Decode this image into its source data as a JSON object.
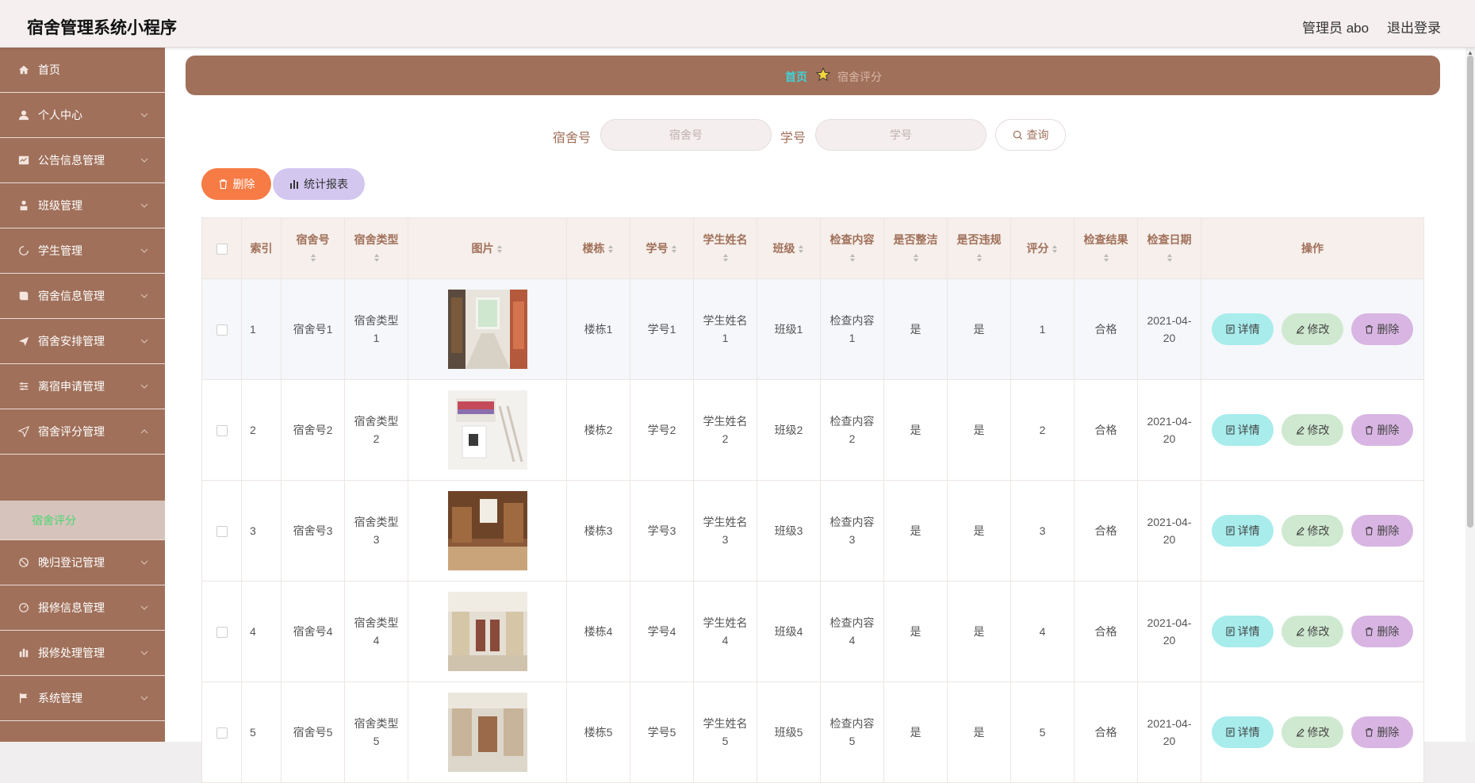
{
  "app": {
    "title": "宿舍管理系统小程序"
  },
  "header": {
    "user": "管理员 abo",
    "logout": "退出登录"
  },
  "sidebar": {
    "items": [
      {
        "label": "首页",
        "icon": "home-icon"
      },
      {
        "label": "个人中心",
        "icon": "user-icon"
      },
      {
        "label": "公告信息管理",
        "icon": "notice-icon"
      },
      {
        "label": "班级管理",
        "icon": "class-icon"
      },
      {
        "label": "学生管理",
        "icon": "student-icon"
      },
      {
        "label": "宿舍信息管理",
        "icon": "dorm-icon"
      },
      {
        "label": "宿舍安排管理",
        "icon": "send-icon"
      },
      {
        "label": "离宿申请管理",
        "icon": "sliders-icon"
      },
      {
        "label": "宿舍评分管理",
        "icon": "navigation-icon"
      },
      {
        "label": "晚归登记管理",
        "icon": "moon-icon"
      },
      {
        "label": "报修信息管理",
        "icon": "tool-icon"
      },
      {
        "label": "报修处理管理",
        "icon": "bar-icon"
      },
      {
        "label": "系统管理",
        "icon": "flag-icon"
      }
    ],
    "subitem": "宿舍评分"
  },
  "breadcrumb": {
    "home": "首页",
    "current": "宿舍评分"
  },
  "search": {
    "dorm_label": "宿舍号",
    "dorm_placeholder": "宿舍号",
    "student_label": "学号",
    "student_placeholder": "学号",
    "query": "查询"
  },
  "actions": {
    "delete": "删除",
    "stats": "统计报表"
  },
  "table": {
    "columns": [
      "索引",
      "宿舍号",
      "宿舍类型",
      "图片",
      "楼栋",
      "学号",
      "学生姓名",
      "班级",
      "检查内容",
      "是否整洁",
      "是否违规",
      "评分",
      "检查结果",
      "检查日期",
      "操作"
    ],
    "rows": [
      {
        "index": "1",
        "dorm": "宿舍号1",
        "type": "宿舍类型1",
        "building": "楼栋1",
        "sid": "学号1",
        "name": "学生姓名1",
        "klass": "班级1",
        "content": "检查内容1",
        "clean": "是",
        "violate": "是",
        "score": "1",
        "result": "合格",
        "date": "2021-04-20"
      },
      {
        "index": "2",
        "dorm": "宿舍号2",
        "type": "宿舍类型2",
        "building": "楼栋2",
        "sid": "学号2",
        "name": "学生姓名2",
        "klass": "班级2",
        "content": "检查内容2",
        "clean": "是",
        "violate": "是",
        "score": "2",
        "result": "合格",
        "date": "2021-04-20"
      },
      {
        "index": "3",
        "dorm": "宿舍号3",
        "type": "宿舍类型3",
        "building": "楼栋3",
        "sid": "学号3",
        "name": "学生姓名3",
        "klass": "班级3",
        "content": "检查内容3",
        "clean": "是",
        "violate": "是",
        "score": "3",
        "result": "合格",
        "date": "2021-04-20"
      },
      {
        "index": "4",
        "dorm": "宿舍号4",
        "type": "宿舍类型4",
        "building": "楼栋4",
        "sid": "学号4",
        "name": "学生姓名4",
        "klass": "班级4",
        "content": "检查内容4",
        "clean": "是",
        "violate": "是",
        "score": "4",
        "result": "合格",
        "date": "2021-04-20"
      },
      {
        "index": "5",
        "dorm": "宿舍号5",
        "type": "宿舍类型5",
        "building": "楼栋5",
        "sid": "学号5",
        "name": "学生姓名5",
        "klass": "班级5",
        "content": "检查内容5",
        "clean": "是",
        "violate": "是",
        "score": "5",
        "result": "合格",
        "date": "2021-04-20"
      }
    ],
    "row_buttons": {
      "detail": "详情",
      "edit": "修改",
      "delete": "删除"
    }
  }
}
